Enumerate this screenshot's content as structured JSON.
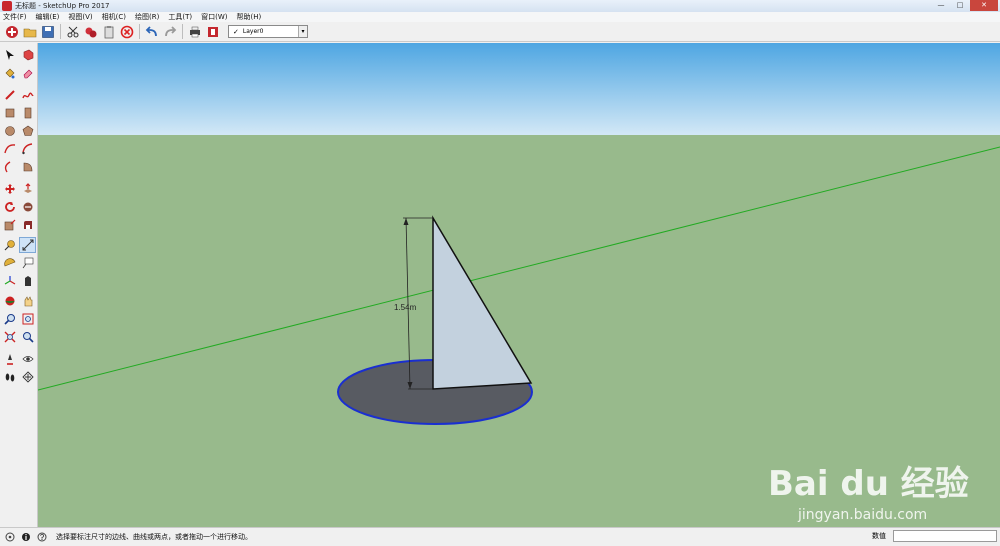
{
  "window": {
    "title": "无标题 - SketchUp Pro 2017",
    "buttons": {
      "minimize": "—",
      "maximize": "□",
      "close": "✕"
    }
  },
  "menu": [
    "文件(F)",
    "编辑(E)",
    "视图(V)",
    "相机(C)",
    "绘图(R)",
    "工具(T)",
    "窗口(W)",
    "帮助(H)"
  ],
  "toolbar": {
    "layer": {
      "check": "✓",
      "value": "Layer0",
      "arrow": "▾"
    }
  },
  "viewport": {
    "colors": {
      "sky_top": "#4ea6e2",
      "sky_bottom": "#d3e8f6",
      "ground": "#98ba8c",
      "green_axis": "#22aa22",
      "disc_fill": "#585b62",
      "disc_edge": "#1a2fd0",
      "triangle_fill": "#c3d1de"
    },
    "dimension_label": "1.54m",
    "watermark": {
      "logo": "Bai du 经验",
      "url": "jingyan.baidu.com"
    }
  },
  "status": {
    "text": "选择要标注尺寸的边线、曲线或两点，或者拖动一个进行移动。",
    "vcb_label": "数值",
    "vcb_value": ""
  }
}
